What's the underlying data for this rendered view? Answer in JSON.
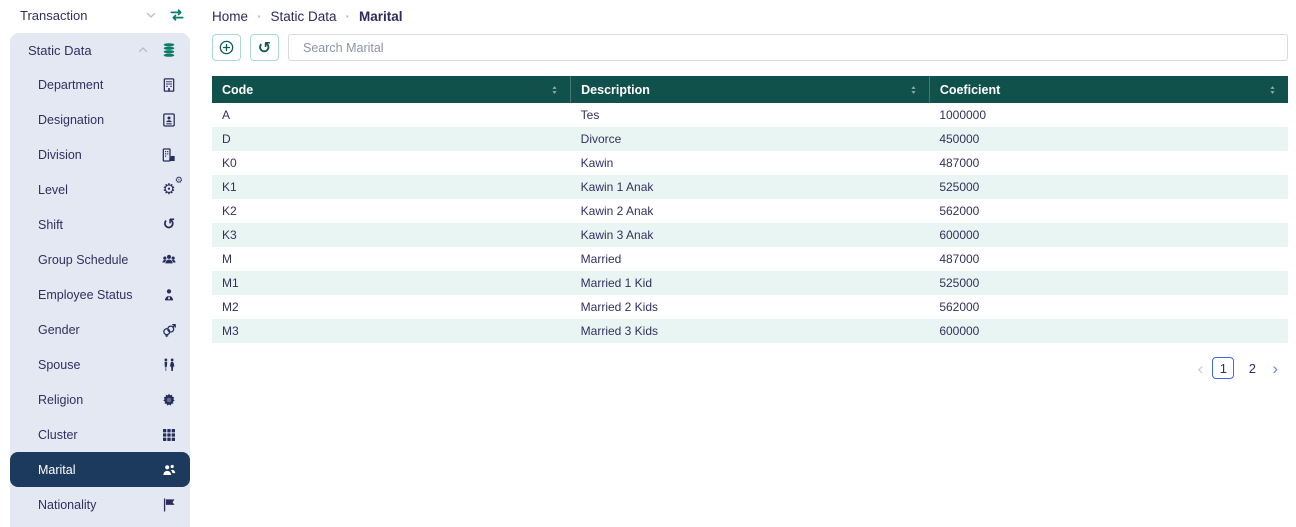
{
  "colors": {
    "header_teal": "#11514c",
    "icon_teal": "#0b7c6c",
    "row_alt": "#e9f5f2",
    "selected_navy": "#1c3a5e",
    "sidebar_group_bg": "#e4e8f2",
    "pagination_blue": "#4263eb",
    "text_navy": "#322f5f"
  },
  "sidebar": {
    "top_item": {
      "label": "Transaction",
      "icon": "swap-arrows-icon",
      "chevron": "chevron-down-icon"
    },
    "group": {
      "label": "Static Data",
      "icon": "database-icon",
      "chevron": "chevron-up-icon",
      "items": [
        {
          "label": "Department",
          "icon": "building-icon",
          "selected": false
        },
        {
          "label": "Designation",
          "icon": "id-card-icon",
          "selected": false
        },
        {
          "label": "Division",
          "icon": "office-icon",
          "selected": false
        },
        {
          "label": "Level",
          "icon": "gears-icon",
          "selected": false
        },
        {
          "label": "Shift",
          "icon": "history-icon",
          "selected": false
        },
        {
          "label": "Group Schedule",
          "icon": "users-group-icon",
          "selected": false
        },
        {
          "label": "Employee Status",
          "icon": "person-badge-icon",
          "selected": false
        },
        {
          "label": "Gender",
          "icon": "gender-icon",
          "selected": false
        },
        {
          "label": "Spouse",
          "icon": "couple-icon",
          "selected": false
        },
        {
          "label": "Religion",
          "icon": "star-seal-icon",
          "selected": false
        },
        {
          "label": "Cluster",
          "icon": "grid-icon",
          "selected": false
        },
        {
          "label": "Marital",
          "icon": "people-icon",
          "selected": true
        },
        {
          "label": "Nationality",
          "icon": "flag-icon",
          "selected": false
        }
      ]
    }
  },
  "breadcrumb": {
    "items": [
      "Home",
      "Static Data",
      "Marital"
    ],
    "separator": "·"
  },
  "toolbar": {
    "add_icon": "plus-circle-icon",
    "refresh_icon": "undo-icon",
    "search_placeholder": "Search Marital",
    "search_value": ""
  },
  "table": {
    "columns": [
      "Code",
      "Description",
      "Coeficient"
    ],
    "rows": [
      {
        "code": "A",
        "description": "Tes",
        "coeficient": "1000000"
      },
      {
        "code": "D",
        "description": "Divorce",
        "coeficient": "450000"
      },
      {
        "code": "K0",
        "description": "Kawin",
        "coeficient": "487000"
      },
      {
        "code": "K1",
        "description": "Kawin 1 Anak",
        "coeficient": "525000"
      },
      {
        "code": "K2",
        "description": "Kawin 2 Anak",
        "coeficient": "562000"
      },
      {
        "code": "K3",
        "description": "Kawin 3 Anak",
        "coeficient": "600000"
      },
      {
        "code": "M",
        "description": "Married",
        "coeficient": "487000"
      },
      {
        "code": "M1",
        "description": "Married 1 Kid",
        "coeficient": "525000"
      },
      {
        "code": "M2",
        "description": "Married 2 Kids",
        "coeficient": "562000"
      },
      {
        "code": "M3",
        "description": "Married 3 Kids",
        "coeficient": "600000"
      }
    ]
  },
  "pagination": {
    "prev": "‹",
    "pages": [
      "1",
      "2"
    ],
    "active_page": "1",
    "next": "›"
  }
}
